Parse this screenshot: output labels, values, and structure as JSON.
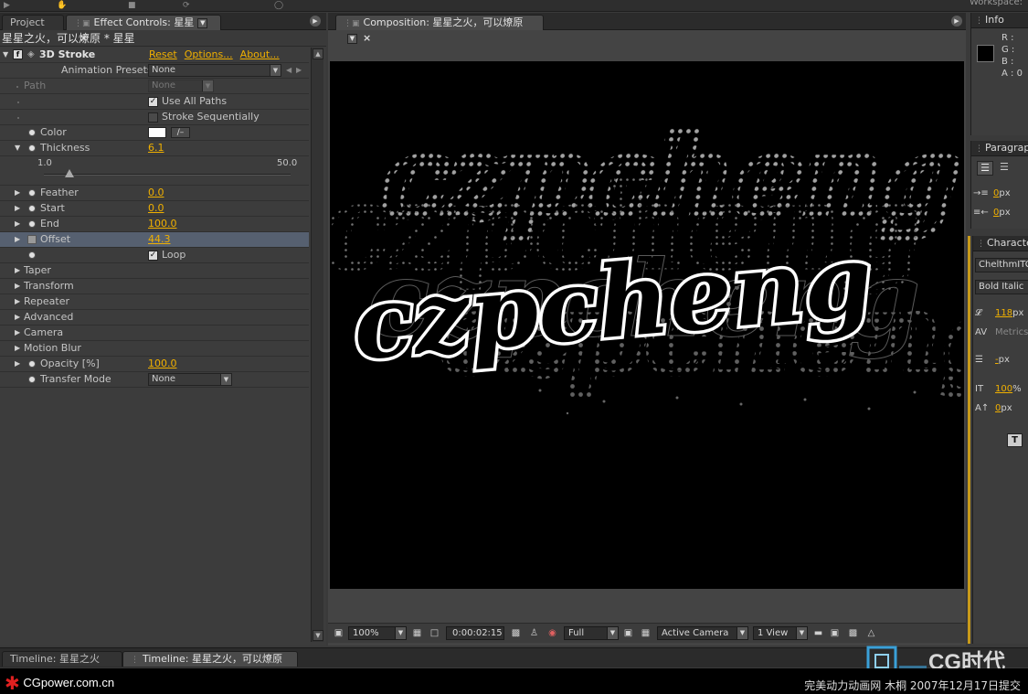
{
  "workspace_label": "Workspace:",
  "left_panel": {
    "tabs": [
      {
        "label": "Project"
      },
      {
        "label": "Effect Controls: 星星"
      }
    ],
    "layer_label": "星星之火，可以燎原 * 星星",
    "effect": {
      "name": "3D Stroke",
      "reset": "Reset",
      "options": "Options...",
      "about": "About...",
      "animation_presets_label": "Animation Presets:",
      "animation_presets_value": "None"
    },
    "params": {
      "path_label": "Path",
      "path_value": "None",
      "use_all_paths": "Use All Paths",
      "stroke_sequentially": "Stroke Sequentially",
      "color": "Color",
      "thickness": "Thickness",
      "thickness_value": "6.1",
      "slider_min": "1.0",
      "slider_max": "50.0",
      "slider_value": 6.1,
      "feather": "Feather",
      "feather_value": "0.0",
      "start": "Start",
      "start_value": "0.0",
      "end": "End",
      "end_value": "100.0",
      "offset": "Offset",
      "offset_value": "44.3",
      "loop": "Loop",
      "taper": "Taper",
      "transform": "Transform",
      "repeater": "Repeater",
      "advanced": "Advanced",
      "camera": "Camera",
      "motion_blur": "Motion Blur",
      "opacity": "Opacity [%]",
      "opacity_value": "100.0",
      "transfer_mode": "Transfer Mode",
      "transfer_mode_value": "None"
    }
  },
  "comp_panel": {
    "tab_label": "Composition: 星星之火，可以燎原",
    "viewer_text": "czpcheng",
    "zoom": "100%",
    "timecode": "0:00:02:15",
    "resolution": "Full",
    "camera": "Active Camera",
    "view": "1 View"
  },
  "right_panel": {
    "info_tab": "Info",
    "info": {
      "r": "R :",
      "g": "G :",
      "b": "B :",
      "a": "A : 0"
    },
    "paragraph_tab": "Paragraph",
    "para_indent_value": "0",
    "para_space_value": "0",
    "unit_px": "px",
    "character_tab": "Character",
    "font_family": "ChelthmITC",
    "font_style": "Bold Italic",
    "font_size": "118",
    "kerning": "Metrics",
    "leading": "-",
    "vertical_scale": "100",
    "percent": "%",
    "baseline_shift": "0"
  },
  "timeline_tabs": [
    {
      "label": "Timeline: 星星之火"
    },
    {
      "label": "Timeline: 星星之火，可以燎原"
    }
  ],
  "footer": {
    "brand": "CGpower.com.cn",
    "logo_text": "CG时代",
    "credit": "完美动力动画网 木桐 2007年12月17日提交"
  },
  "colors": {
    "accent": "#f0b000",
    "panel_bg": "#3c3c3c",
    "selected_row": "#566070"
  }
}
